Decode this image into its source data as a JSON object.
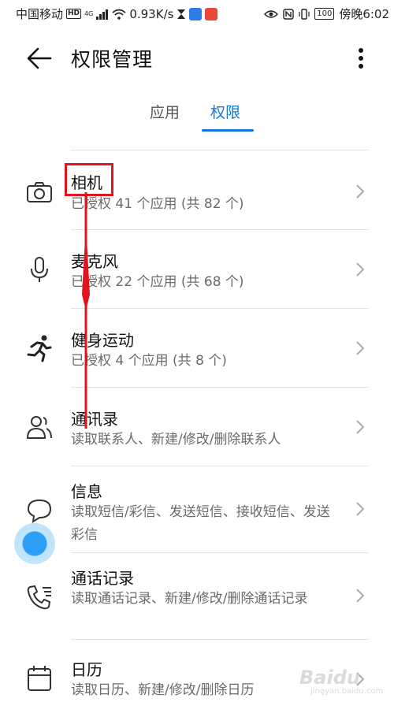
{
  "status_bar": {
    "carrier": "中国移动",
    "hd": "HD",
    "network": "4G",
    "speed": "0.93K/s",
    "battery": "100",
    "time": "傍晚6:02"
  },
  "header": {
    "title": "权限管理"
  },
  "tabs": [
    {
      "label": "应用"
    },
    {
      "label": "权限"
    }
  ],
  "permissions": [
    {
      "title": "相机",
      "subtitle": "已授权 41 个应用 (共 82 个)"
    },
    {
      "title": "麦克风",
      "subtitle": "已授权 22 个应用 (共 68 个)"
    },
    {
      "title": "健身运动",
      "subtitle": "已授权 4 个应用 (共 8 个)"
    },
    {
      "title": "通讯录",
      "subtitle": "读取联系人、新建/修改/删除联系人"
    },
    {
      "title": "信息",
      "subtitle": "读取短信/彩信、发送短信、接收短信、发送彩信"
    },
    {
      "title": "通话记录",
      "subtitle": "读取通话记录、新建/修改/删除通话记录"
    },
    {
      "title": "日历",
      "subtitle": "读取日历、新建/修改/删除日历"
    }
  ],
  "watermark": {
    "logo": "Baidu",
    "sub": "jingyan.baidu.com"
  },
  "colors": {
    "accent": "#1277d8",
    "highlight": "#e0141e"
  }
}
